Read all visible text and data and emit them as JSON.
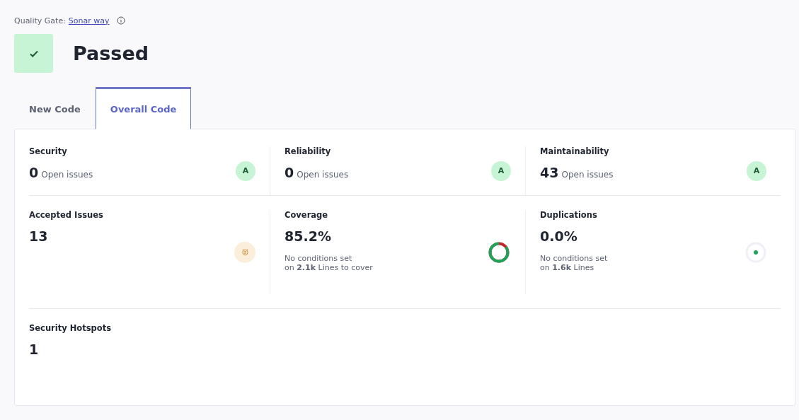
{
  "quality_gate": {
    "label": "Quality Gate:",
    "link": "Sonar way",
    "status": "Passed",
    "passed": true
  },
  "tabs": [
    {
      "label": "New Code",
      "selected": false
    },
    {
      "label": "Overall Code",
      "selected": true
    }
  ],
  "rows": [
    [
      {
        "kind": "rating",
        "title": "Security",
        "value": "0",
        "unit": "Open issues",
        "rating": "A"
      },
      {
        "kind": "rating",
        "title": "Reliability",
        "value": "0",
        "unit": "Open issues",
        "rating": "A"
      },
      {
        "kind": "rating",
        "title": "Maintainability",
        "value": "43",
        "unit": "Open issues",
        "rating": "A"
      }
    ],
    [
      {
        "kind": "accepted",
        "title": "Accepted Issues",
        "value": "13"
      },
      {
        "kind": "coverage",
        "title": "Coverage",
        "value": "85.2%",
        "note": "No conditions set",
        "detail": "on **2.1k** Lines to cover"
      },
      {
        "kind": "duplication",
        "title": "Duplications",
        "value": "0.0%",
        "note": "No conditions set",
        "detail": "on **1.6k** Lines"
      }
    ],
    [
      {
        "kind": "plain",
        "title": "Security Hotspots",
        "value": "1"
      }
    ]
  ]
}
